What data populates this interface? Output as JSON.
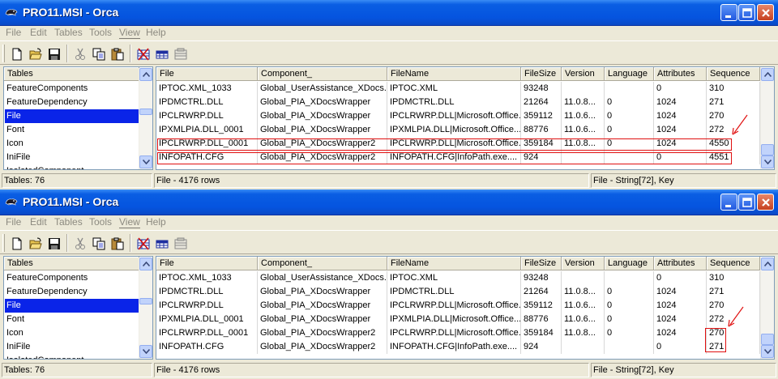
{
  "colors": {
    "title_bar": "#0554df",
    "selection": "#0a24e8",
    "annotation": "#e01010"
  },
  "icons": {
    "app": "orca-app-icon",
    "toolbar": [
      "new-file-icon",
      "open-folder-icon",
      "save-icon",
      "cut-icon",
      "copy-icon",
      "paste-icon",
      "table-properties-icon",
      "add-row-icon",
      "transform-icon"
    ],
    "scroll": [
      "scroll-up-arrow-icon",
      "scroll-down-arrow-icon"
    ]
  },
  "windows": [
    {
      "title": "PRO11.MSI - Orca",
      "menu": [
        "File",
        "Edit",
        "Tables",
        "Tools",
        "View",
        "Help"
      ],
      "tables_header": "Tables",
      "tables": [
        "FeatureComponents",
        "FeatureDependency",
        "File",
        "Font",
        "Icon",
        "IniFile",
        "IsolatedComponent"
      ],
      "selected_table": "File",
      "columns": [
        "File",
        "Component_",
        "FileName",
        "FileSize",
        "Version",
        "Language",
        "Attributes",
        "Sequence"
      ],
      "rows": [
        [
          "IPTOC.XML_1033",
          "Global_UserAssistance_XDocs...",
          "IPTOC.XML",
          "93248",
          "",
          "",
          "0",
          "310"
        ],
        [
          "IPDMCTRL.DLL",
          "Global_PIA_XDocsWrapper",
          "IPDMCTRL.DLL",
          "21264",
          "11.0.8...",
          "0",
          "1024",
          "271"
        ],
        [
          "IPCLRWRP.DLL",
          "Global_PIA_XDocsWrapper",
          "IPCLRWRP.DLL|Microsoft.Office...",
          "359112",
          "11.0.6...",
          "0",
          "1024",
          "270"
        ],
        [
          "IPXMLPIA.DLL_0001",
          "Global_PIA_XDocsWrapper",
          "IPXMLPIA.DLL|Microsoft.Office...",
          "88776",
          "11.0.6...",
          "0",
          "1024",
          "272"
        ],
        [
          "IPCLRWRP.DLL_0001",
          "Global_PIA_XDocsWrapper2",
          "IPCLRWRP.DLL|Microsoft.Office...",
          "359184",
          "11.0.8...",
          "0",
          "1024",
          "4550"
        ],
        [
          "INFOPATH.CFG",
          "Global_PIA_XDocsWrapper2",
          "INFOPATH.CFG|InfoPath.exe....",
          "924",
          "",
          "",
          "0",
          "4551"
        ]
      ],
      "status": {
        "tables_count": "Tables: 76",
        "rows": "File - 4176 rows",
        "column_info": "File - String[72], Key"
      }
    },
    {
      "title": "PRO11.MSI - Orca",
      "menu": [
        "File",
        "Edit",
        "Tables",
        "Tools",
        "View",
        "Help"
      ],
      "tables_header": "Tables",
      "tables": [
        "FeatureComponents",
        "FeatureDependency",
        "File",
        "Font",
        "Icon",
        "IniFile",
        "IsolatedComponent"
      ],
      "selected_table": "File",
      "columns": [
        "File",
        "Component_",
        "FileName",
        "FileSize",
        "Version",
        "Language",
        "Attributes",
        "Sequence"
      ],
      "rows": [
        [
          "IPTOC.XML_1033",
          "Global_UserAssistance_XDocs...",
          "IPTOC.XML",
          "93248",
          "",
          "",
          "0",
          "310"
        ],
        [
          "IPDMCTRL.DLL",
          "Global_PIA_XDocsWrapper",
          "IPDMCTRL.DLL",
          "21264",
          "11.0.8...",
          "0",
          "1024",
          "271"
        ],
        [
          "IPCLRWRP.DLL",
          "Global_PIA_XDocsWrapper",
          "IPCLRWRP.DLL|Microsoft.Office...",
          "359112",
          "11.0.6...",
          "0",
          "1024",
          "270"
        ],
        [
          "IPXMLPIA.DLL_0001",
          "Global_PIA_XDocsWrapper",
          "IPXMLPIA.DLL|Microsoft.Office...",
          "88776",
          "11.0.6...",
          "0",
          "1024",
          "272"
        ],
        [
          "IPCLRWRP.DLL_0001",
          "Global_PIA_XDocsWrapper2",
          "IPCLRWRP.DLL|Microsoft.Office...",
          "359184",
          "11.0.8...",
          "0",
          "1024",
          "270"
        ],
        [
          "INFOPATH.CFG",
          "Global_PIA_XDocsWrapper2",
          "INFOPATH.CFG|InfoPath.exe....",
          "924",
          "",
          "",
          "0",
          "271"
        ]
      ],
      "status": {
        "tables_count": "Tables: 76",
        "rows": "File - 4176 rows",
        "column_info": "File - String[72], Key"
      }
    }
  ]
}
